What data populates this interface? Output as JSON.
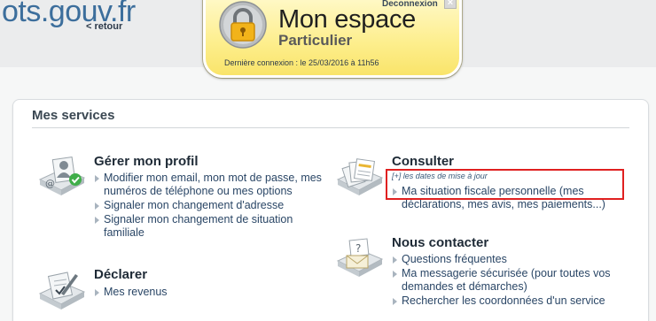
{
  "header": {
    "site_title": "ots.gouv.fr",
    "retour_label": "< retour"
  },
  "espace": {
    "title": "Mon espace",
    "subtitle": "Particulier",
    "deconnexion_label": "Deconnexion",
    "close_symbol": "×",
    "last_login": "Dernière connexion : le 25/03/2016 à 11h56",
    "icon": "lock-icon"
  },
  "services": {
    "heading": "Mes services",
    "profil": {
      "title": "Gérer mon profil",
      "icon": "profile-icon",
      "links": [
        "Modifier mon email, mon mot de passe, mes numéros de téléphone ou mes options",
        "Signaler mon changement d'adresse",
        "Signaler mon changement de situation familiale"
      ]
    },
    "declarer": {
      "title": "Déclarer",
      "icon": "declare-icon",
      "links": [
        "Mes revenus"
      ]
    },
    "consulter": {
      "title": "Consulter",
      "icon": "documents-icon",
      "note": "[+] les dates de mise à jour",
      "links": [
        "Ma situation fiscale personnelle (mes déclarations, mes avis, mes paiements...)"
      ]
    },
    "contact": {
      "title": "Nous contacter",
      "icon": "mail-icon",
      "links": [
        "Questions fréquentes",
        "Ma messagerie sécurisée (pour toutes vos demandes et démarches)",
        "Rechercher les coordonnées d'un service"
      ]
    }
  },
  "colors": {
    "panel_yellow": "#fdee8c",
    "link_blue": "#2a4666",
    "highlight_red": "#e02020"
  }
}
